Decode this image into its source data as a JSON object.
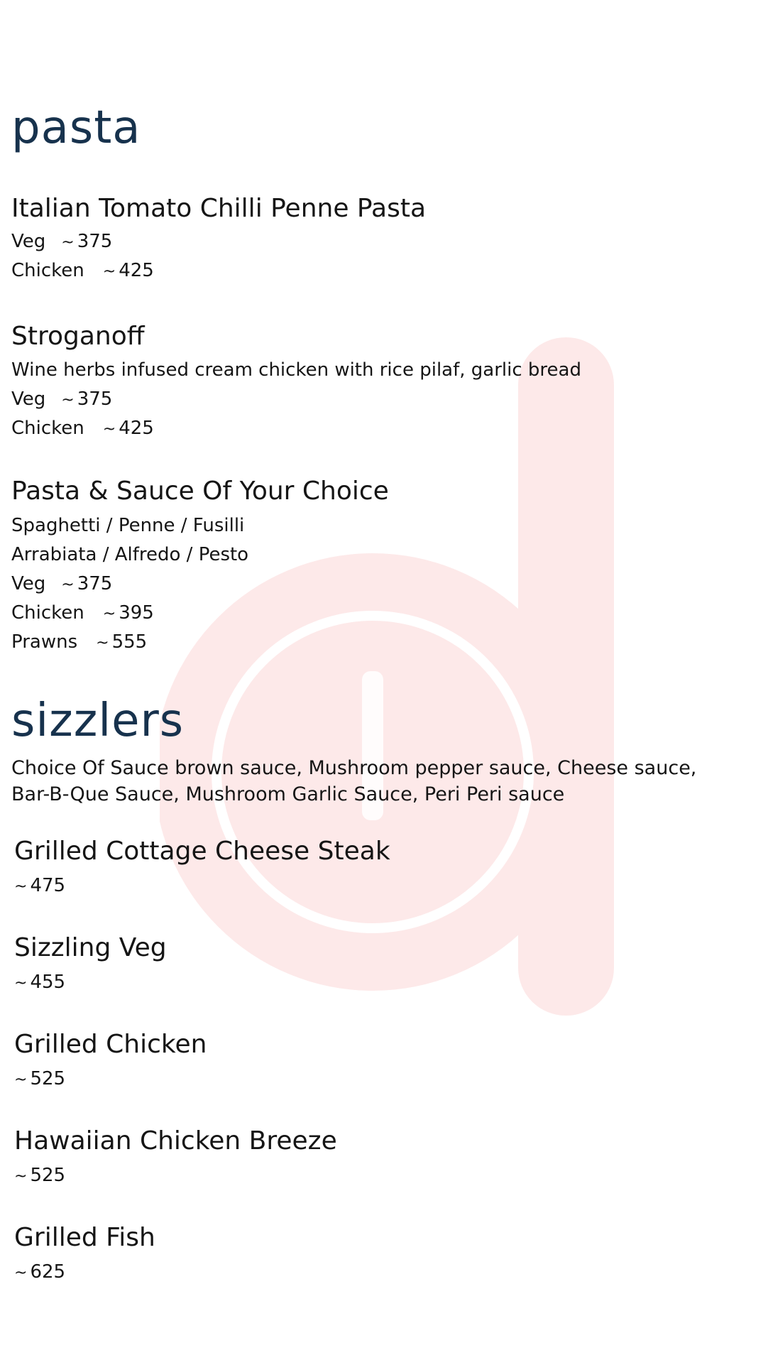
{
  "colors": {
    "heading": "#17324d",
    "text": "#151515",
    "watermark": "#fde9e9"
  },
  "watermark_icon": "d-logo-watermark",
  "sections": {
    "pasta": {
      "title": "pasta",
      "items": [
        {
          "name": "Italian Tomato Chilli Penne Pasta",
          "prices": [
            {
              "label": "Veg",
              "price": "375"
            },
            {
              "label": "Chicken",
              "price": "425"
            }
          ]
        },
        {
          "name": "Stroganoff",
          "description": "Wine herbs infused cream chicken with rice pilaf, garlic bread",
          "prices": [
            {
              "label": "Veg",
              "price": "375"
            },
            {
              "label": "Chicken",
              "price": "425"
            }
          ]
        },
        {
          "name": "Pasta & Sauce Of Your Choice",
          "options": [
            "Spaghetti / Penne / Fusilli",
            "Arrabiata / Alfredo / Pesto"
          ],
          "prices": [
            {
              "label": "Veg",
              "price": "375"
            },
            {
              "label": "Chicken",
              "price": "395"
            },
            {
              "label": "Prawns",
              "price": "555"
            }
          ]
        }
      ]
    },
    "sizzlers": {
      "title": "sizzlers",
      "sauce_note_line1": "Choice Of Sauce brown  sauce, Mushroom pepper sauce, Cheese sauce,",
      "sauce_note_line2": "Bar-B-Que Sauce, Mushroom  Garlic Sauce, Peri Peri sauce",
      "items": [
        {
          "name": "Grilled Cottage Cheese Steak",
          "price": "475"
        },
        {
          "name": "Sizzling Veg",
          "price": "455"
        },
        {
          "name": "Grilled Chicken",
          "price": "525"
        },
        {
          "name": "Hawaiian Chicken Breeze",
          "price": "525"
        },
        {
          "name": "Grilled Fish",
          "price": "625"
        }
      ]
    }
  },
  "currency_symbol": "~"
}
